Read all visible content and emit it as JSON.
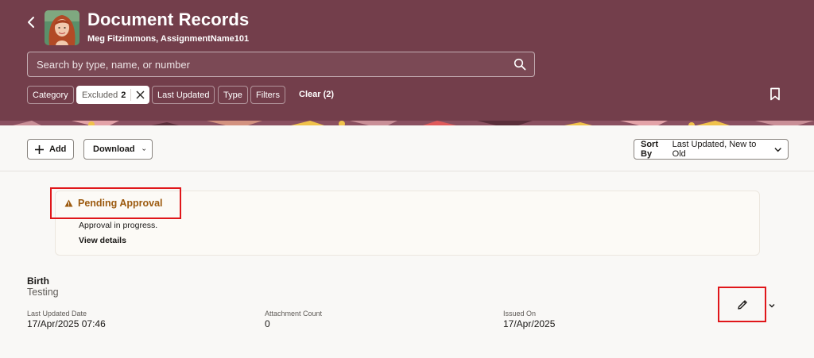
{
  "header": {
    "title": "Document Records",
    "subtitle": "Meg Fitzimmons, AssignmentName101",
    "back_icon": "chevron-left-icon",
    "background_color": "#733e4b"
  },
  "search": {
    "placeholder": "Search by type, name, or number",
    "value": ""
  },
  "filters": {
    "chips": [
      {
        "label": "Category"
      },
      {
        "label": "Excluded",
        "count": "2",
        "active": true
      },
      {
        "label": "Last Updated"
      },
      {
        "label": "Type"
      },
      {
        "label": "Filters"
      }
    ],
    "clear_label": "Clear (2)"
  },
  "toolbar": {
    "add_label": "Add",
    "download_label": "Download",
    "sort_prefix": "Sort By",
    "sort_value": "Last Updated, New to Old"
  },
  "pending": {
    "title": "Pending Approval",
    "message": "Approval in progress.",
    "link": "View details",
    "accent_color": "#9c5a0f"
  },
  "record": {
    "title": "Birth",
    "subtitle": "Testing",
    "fields": [
      {
        "label": "Last Updated Date",
        "value": "17/Apr/2025 07:46"
      },
      {
        "label": "Attachment Count",
        "value": "0"
      },
      {
        "label": "Issued On",
        "value": "17/Apr/2025"
      }
    ]
  }
}
